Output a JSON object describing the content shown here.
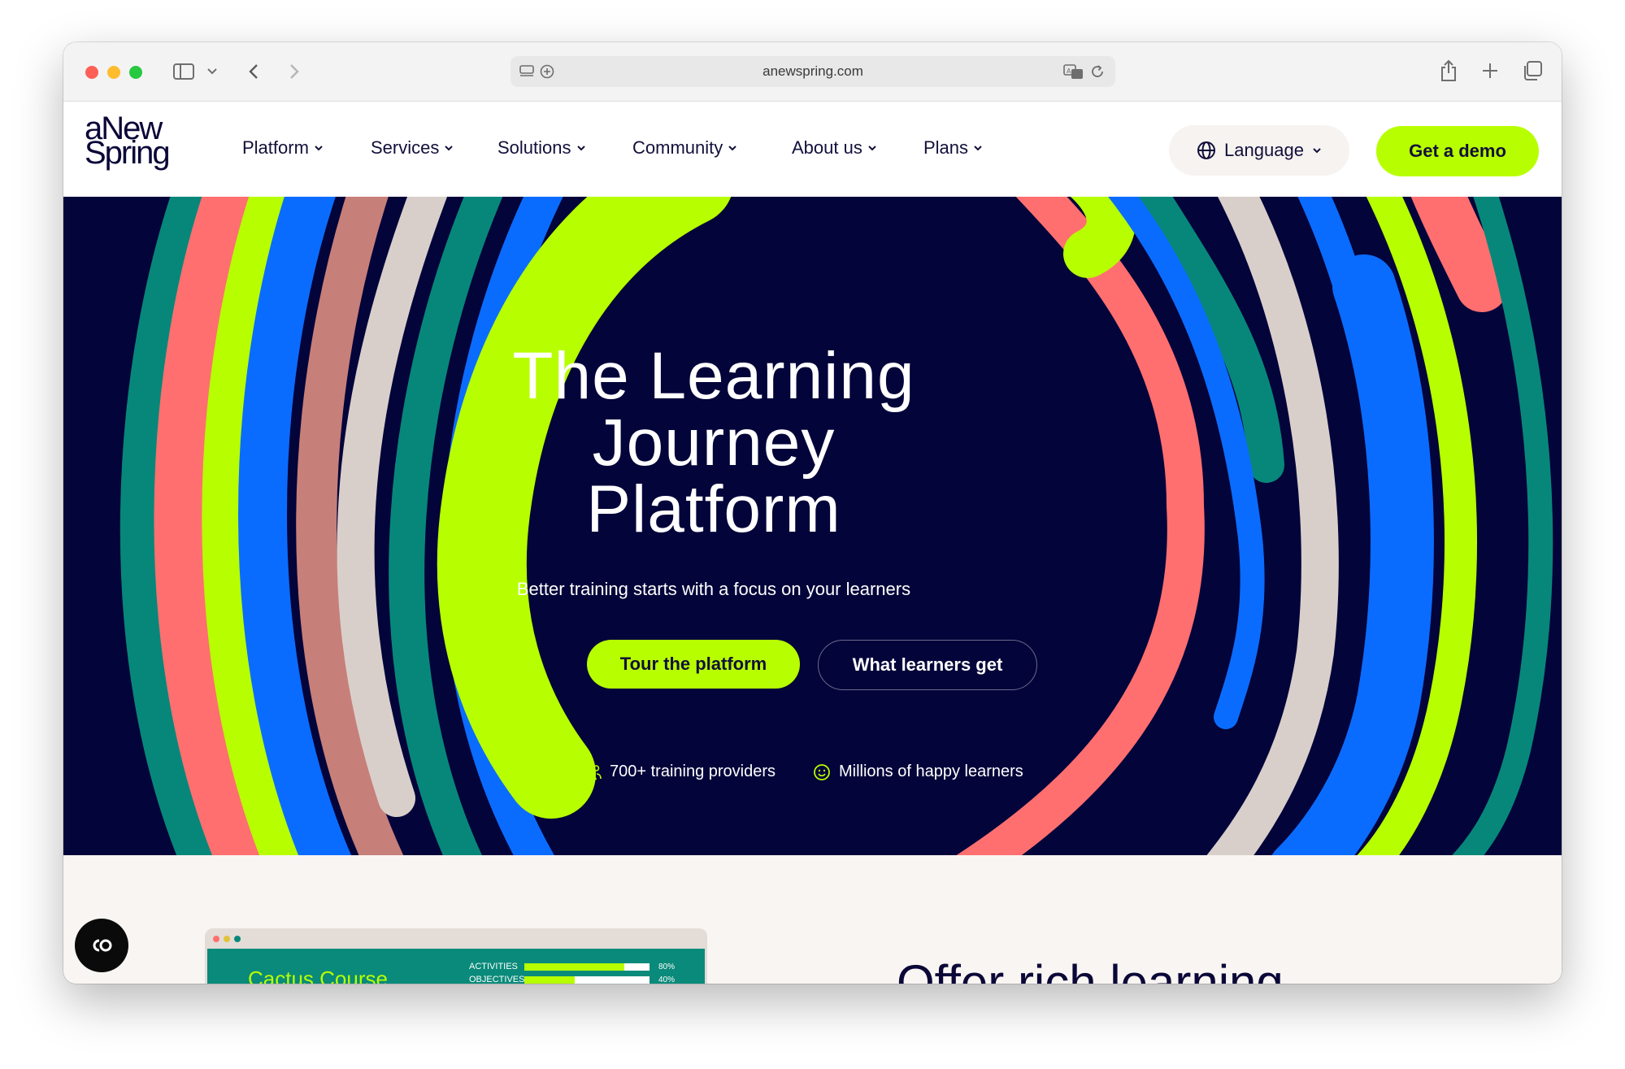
{
  "browser": {
    "url": "anewspring.com",
    "icons": [
      "sidebar-icon",
      "chevron-down-icon",
      "back-icon",
      "forward-icon",
      "reader-icon",
      "add-extension-icon",
      "translate-icon",
      "reload-icon",
      "share-icon",
      "new-tab-icon",
      "tabs-overview-icon"
    ]
  },
  "nav": {
    "logo_line1": "aNew",
    "logo_line2": "Spring",
    "items": [
      {
        "label": "Platform"
      },
      {
        "label": "Services"
      },
      {
        "label": "Solutions"
      },
      {
        "label": "Community"
      },
      {
        "label": "About us"
      },
      {
        "label": "Plans"
      }
    ],
    "language_label": "Language",
    "demo_label": "Get a demo"
  },
  "hero": {
    "title_line1": "The Learning",
    "title_line2": "Journey",
    "title_line3": "Platform",
    "subtitle": "Better training starts with a focus on your learners",
    "cta_primary": "Tour the platform",
    "cta_secondary": "What learners get",
    "stat1": "700+ training providers",
    "stat2": "Millions of happy learners"
  },
  "preview": {
    "course_title": "Cactus Course",
    "rows": [
      {
        "label": "ACTIVITIES",
        "percent_text": "80%",
        "fill": 0.8
      },
      {
        "label": "OBJECTIVES",
        "percent_text": "40%",
        "fill": 0.4
      }
    ]
  },
  "section": {
    "heading": "Offer rich learning"
  },
  "colors": {
    "brand_navy": "#03043a",
    "brand_lime": "#b7ff00",
    "coral": "#ff6f6f",
    "teal": "#07877a",
    "blue": "#0a6cff",
    "beige": "#d9cfca"
  }
}
